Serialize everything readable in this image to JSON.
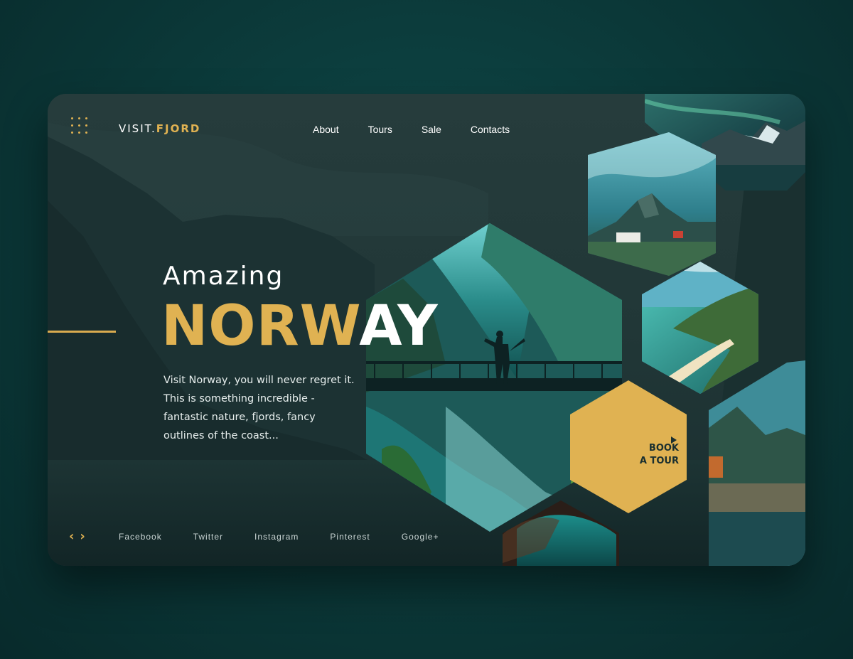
{
  "brand": {
    "part1": "VISIT.",
    "part2": "FJORD"
  },
  "nav": {
    "items": [
      "About",
      "Tours",
      "Sale",
      "Contacts"
    ]
  },
  "hero": {
    "eyebrow": "Amazing",
    "title_gold": "NORW",
    "title_white": "AY",
    "description": "Visit Norway, you will never regret it. This is something incredible - fantastic nature, fjords, fancy outlines of the coast..."
  },
  "cta": {
    "line1": "BOOK",
    "line2": "A TOUR",
    "icon": "play-icon"
  },
  "pager": {
    "prev": "‹",
    "next": "›"
  },
  "social": [
    "Facebook",
    "Twitter",
    "Instagram",
    "Pinterest",
    "Google+"
  ],
  "colors": {
    "accent": "#e0b252",
    "card": "#1d3535",
    "background": "#0b3838"
  }
}
